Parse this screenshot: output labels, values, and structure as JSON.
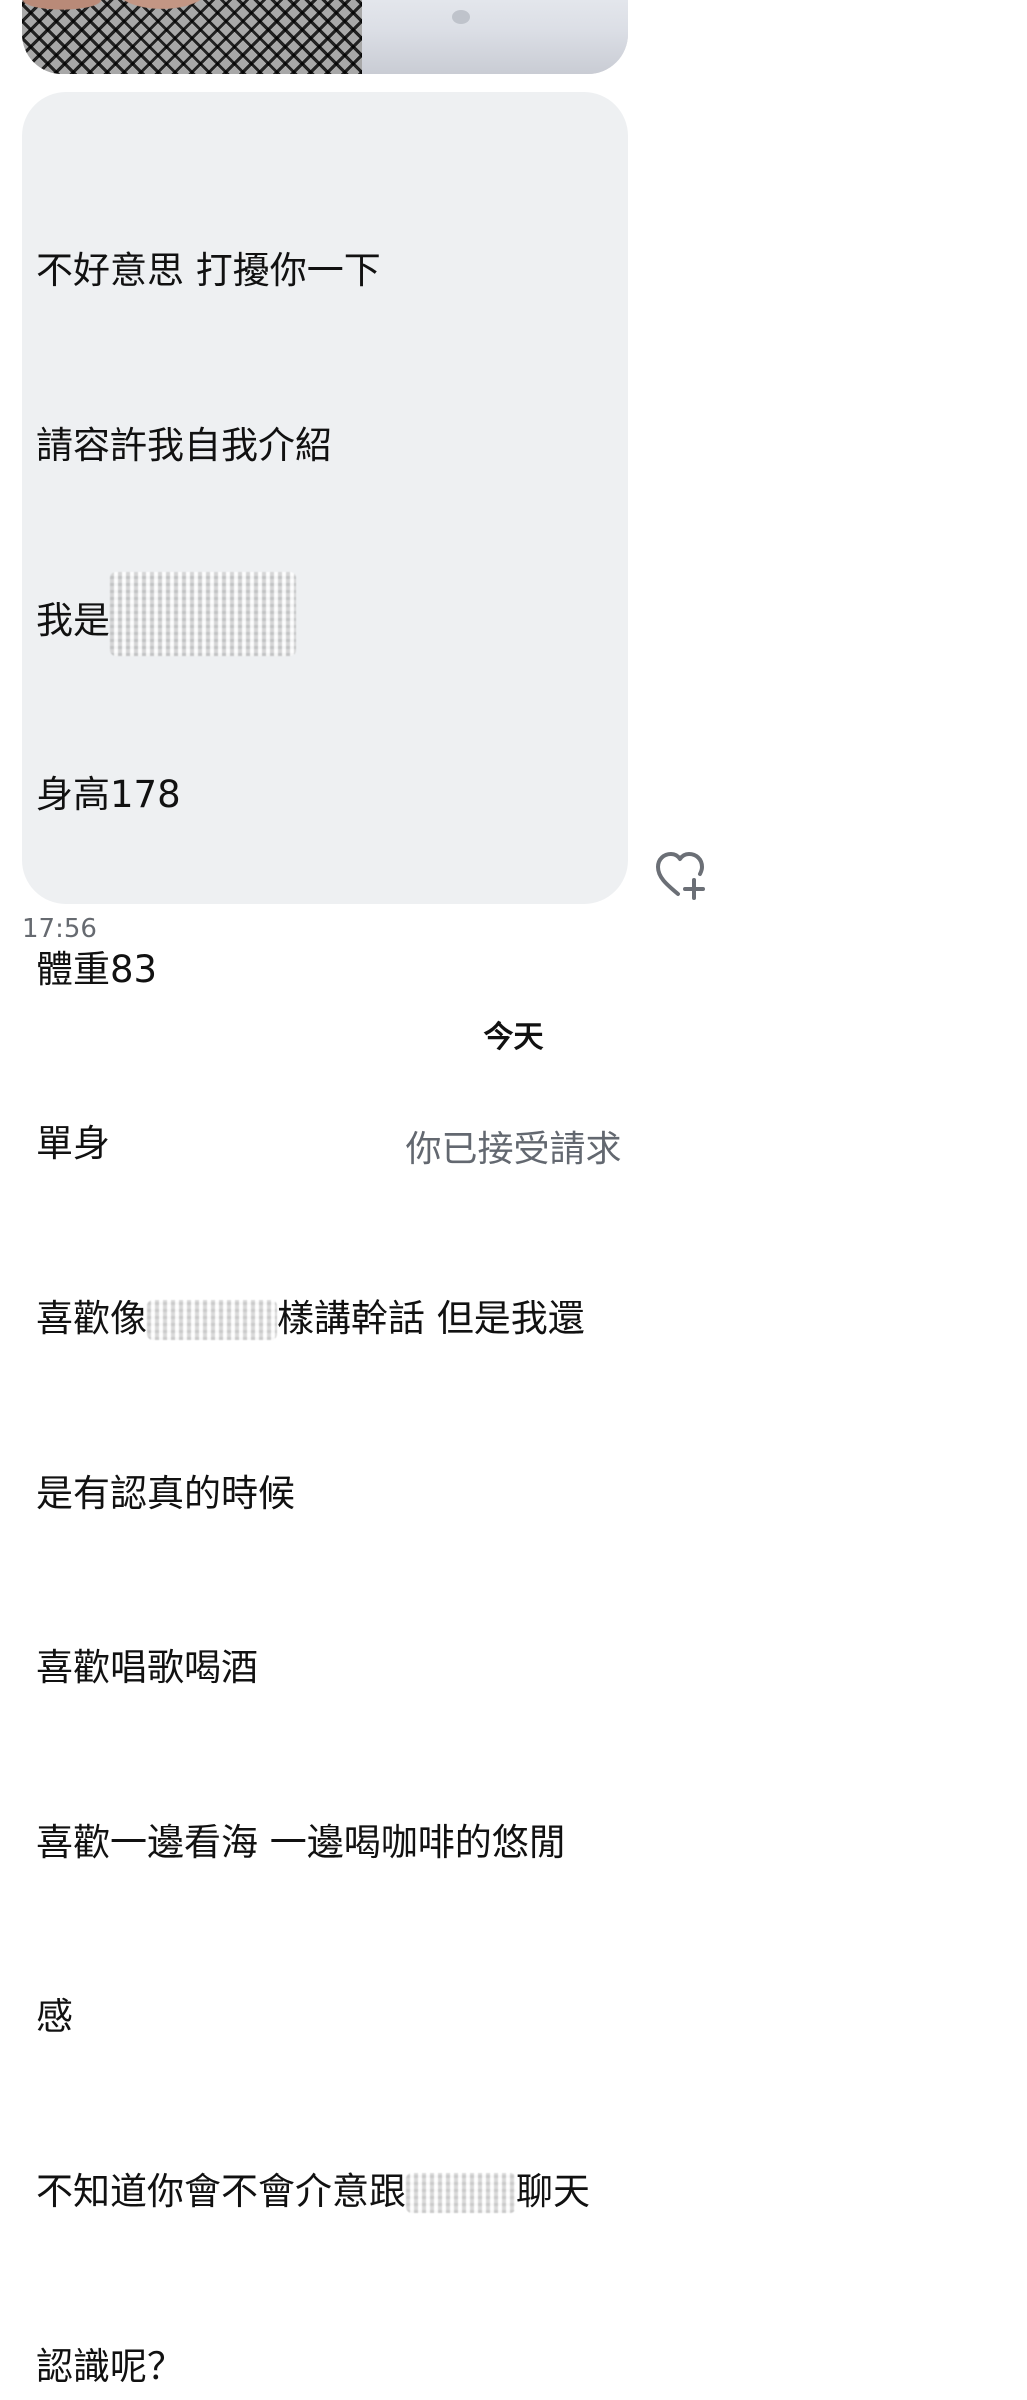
{
  "message": {
    "lines": [
      "不好意思 打擾你一下",
      "請容許我自我介紹",
      "我是",
      "身高178",
      "體重83",
      "單身",
      "喜歡像",
      "樣講幹話 但是我還",
      "是有認真的時候",
      "喜歡唱歌喝酒",
      "喜歡一邊看海 一邊喝咖啡的悠閒",
      "感",
      "不知道你會不會介意跟",
      "聊天",
      "認識呢？"
    ],
    "timestamp": "17:56"
  },
  "actions": {
    "like_icon": "heart-plus-icon"
  },
  "date_divider": "今天",
  "system_note": "你已接受請求",
  "colors": {
    "bubble": "#eef0f2",
    "timestamp": "#666a70",
    "system_note": "#636870"
  }
}
